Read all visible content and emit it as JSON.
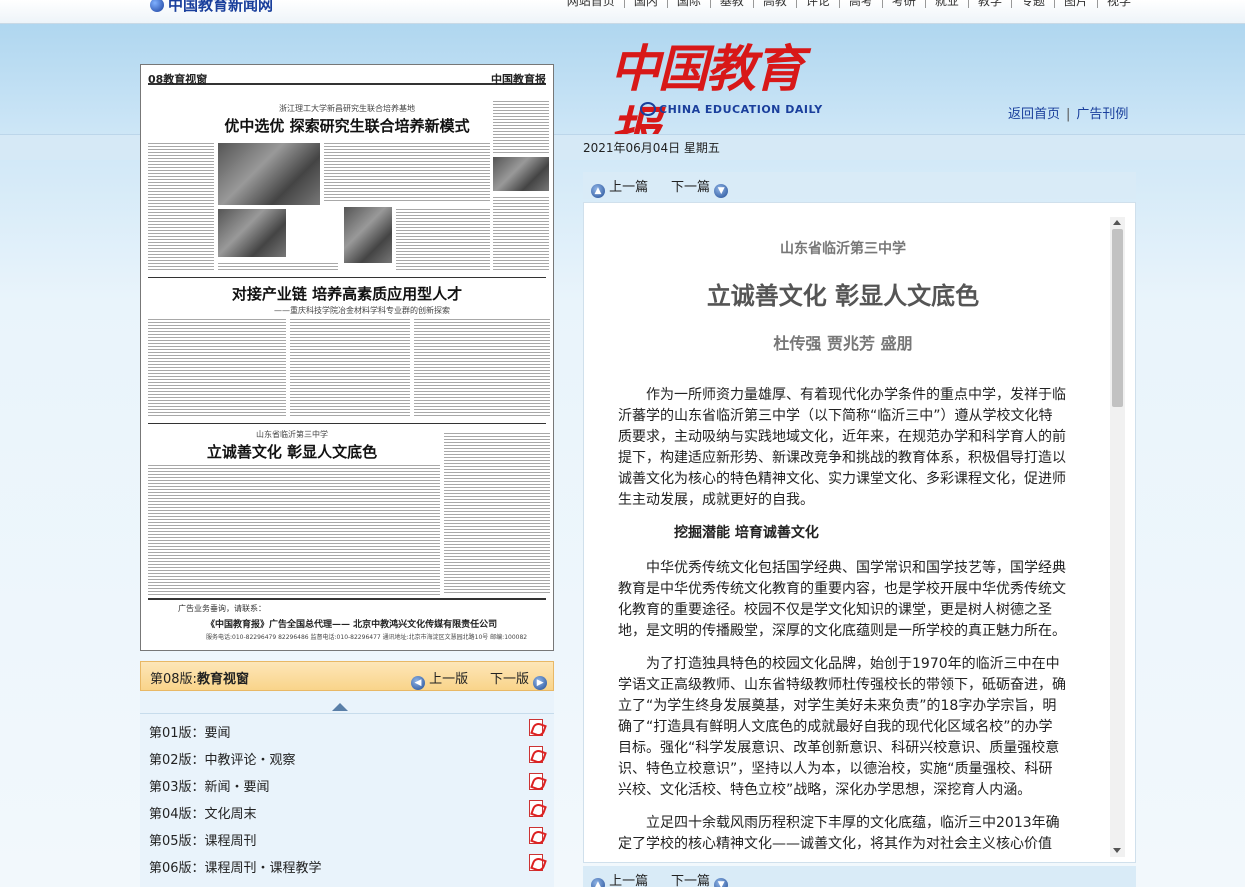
{
  "site": {
    "logo_text": "中国教育新闻网",
    "nav": [
      "网站首页",
      "国内",
      "国际",
      "基教",
      "高教",
      "评论",
      "高考",
      "考研",
      "就业",
      "教学",
      "专题",
      "图片",
      "视学"
    ]
  },
  "masthead": {
    "title": "中国教育报",
    "subtitle": "CHINA EDUCATION DAILY",
    "links": [
      "返回首页",
      "广告刊例"
    ]
  },
  "date": "2021年06月04日  星期五",
  "page_preview": {
    "header_left": "08教育视窗",
    "header_right": "中国教育报",
    "headline1_kicker": "浙江理工大学新昌研究生联合培养基地",
    "headline1": "优中选优   探索研究生联合培养新模式",
    "headline2": "对接产业链   培养高素质应用型人才",
    "headline2_sub": "——重庆科技学院冶金材料学科专业群的创新探索",
    "headline3_kicker": "山东省临沂第三中学",
    "headline3": "立诚善文化   彰显人文底色",
    "ad_line1": "广告业务垂询，请联系：",
    "ad_line2": "《中国教育报》广告全国总代理—— 北京中教鸿兴文化传媒有限责任公司",
    "ad_line3": "服务电话:010-82296479 82296486   监督电话:010-82296477   通讯地址:北京市海淀区文慧园北路10号   邮编:100082"
  },
  "edition_bar": {
    "edition_prefix": "第08版:",
    "edition_name": "教育视窗",
    "prev": "上一版",
    "next": "下一版"
  },
  "edition_list": [
    "第01版：要闻",
    "第02版：中教评论・观察",
    "第03版：新闻・要闻",
    "第04版：文化周末",
    "第05版：课程周刊",
    "第06版：课程周刊・课程教学"
  ],
  "article_nav": {
    "prev": "上一篇",
    "next": "下一篇"
  },
  "article": {
    "kicker": "山东省临沂第三中学",
    "title": "立诚善文化  彰显人文底色",
    "authors": "杜传强  贾兆芳  盛朋",
    "p1": "作为一所师资力量雄厚、有着现代化办学条件的重点中学，发祥于临沂蕃学的山东省临沂第三中学（以下简称“临沂三中”）遵从学校文化特质要求，主动吸纳与实践地域文化，近年来，在规范办学和科学育人的前提下，构建适应新形势、新课改竞争和挑战的教育体系，积极倡导打造以诚善文化为核心的特色精神文化、实力课堂文化、多彩课程文化，促进师生主动发展，成就更好的自我。",
    "h1": "挖掘潜能   培育诚善文化",
    "p2": "中华优秀传统文化包括国学经典、国学常识和国学技艺等，国学经典教育是中华优秀传统文化教育的重要内容，也是学校开展中华优秀传统文化教育的重要途径。校园不仅是学文化知识的课堂，更是树人树德之圣地，是文明的传播殿堂，深厚的文化底蕴则是一所学校的真正魅力所在。",
    "p3": "为了打造独具特色的校园文化品牌，始创于1970年的临沂三中在中学语文正高级教师、山东省特级教师杜传强校长的带领下，砥砺奋进，确立了“为学生终身发展奠基，对学生美好未来负责”的18字办学宗旨，明确了“打造具有鲜明人文底色的成就最好自我的现代化区域名校”的办学目标。强化“科学发展意识、改革创新意识、科研兴校意识、质量强校意识、特色立校意识”，坚持以人为本，以德治校，实施“质量强校、科研兴校、文化活校、特色立校”战略，深化办学思想，深挖育人内涵。",
    "p4": "立足四十余载风雨历程积淀下丰厚的文化底蕴，临沂三中2013年确定了学校的核心精神文化——诚善文化，将其作为对社会主义核心价值"
  }
}
